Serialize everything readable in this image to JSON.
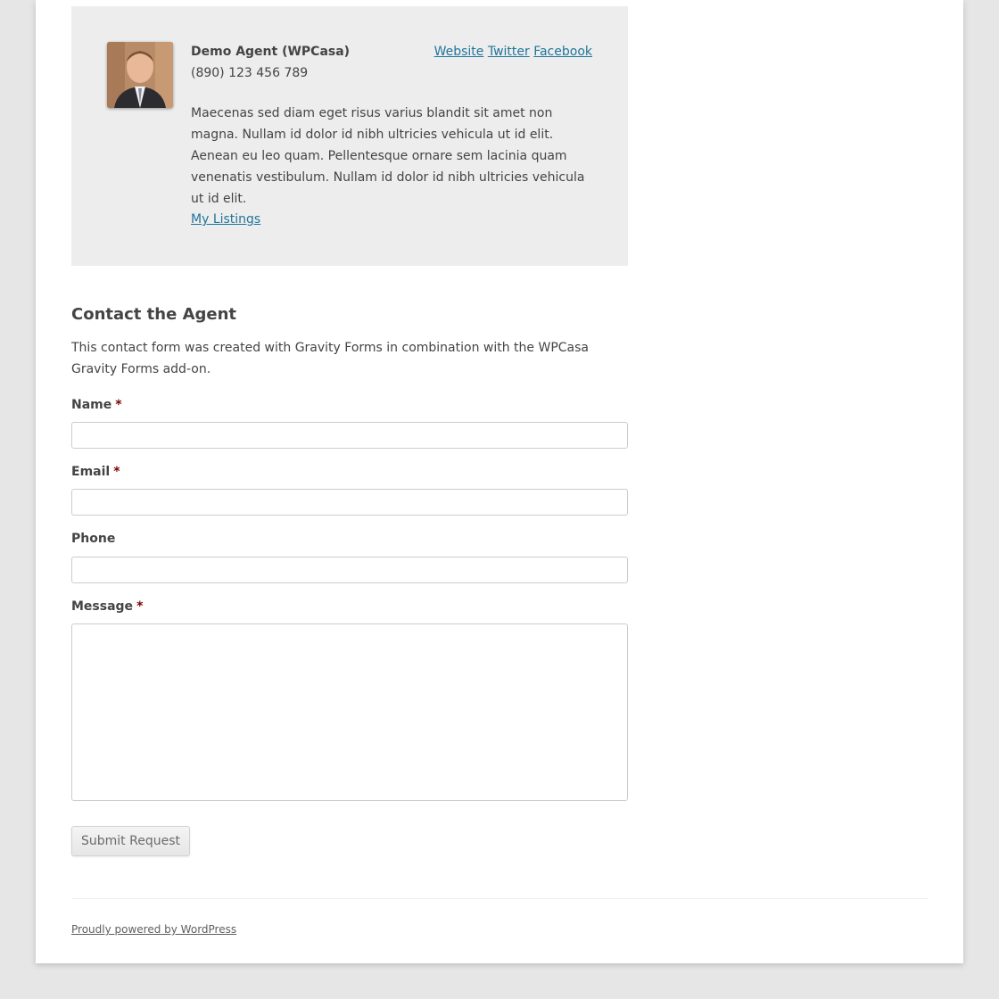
{
  "agent": {
    "name": "Demo Agent (WPCasa)",
    "phone": "(890) 123 456 789",
    "links": {
      "website": "Website",
      "twitter": "Twitter",
      "facebook": "Facebook"
    },
    "bio": "Maecenas sed diam eget risus varius blandit sit amet non magna. Nullam id dolor id nibh ultricies vehicula ut id elit. Aenean eu leo quam. Pellentesque ornare sem lacinia quam venenatis vestibulum. Nullam id dolor id nibh ultricies vehicula ut id elit.",
    "listings_link": "My Listings"
  },
  "contact": {
    "title": "Contact the Agent",
    "description": "This contact form was created with Gravity Forms in combination with the WPCasa Gravity Forms add-on.",
    "required_marker": "*",
    "fields": {
      "name": {
        "label": "Name",
        "value": ""
      },
      "email": {
        "label": "Email",
        "value": ""
      },
      "phone": {
        "label": "Phone",
        "value": ""
      },
      "message": {
        "label": "Message",
        "value": ""
      }
    },
    "submit_label": "Submit Request"
  },
  "footer": {
    "powered_by": "Proudly powered by WordPress"
  },
  "colors": {
    "link": "#21759b",
    "required": "#790000",
    "agent_box_bg": "#ededed",
    "outer_bg": "#e6e6e6"
  }
}
